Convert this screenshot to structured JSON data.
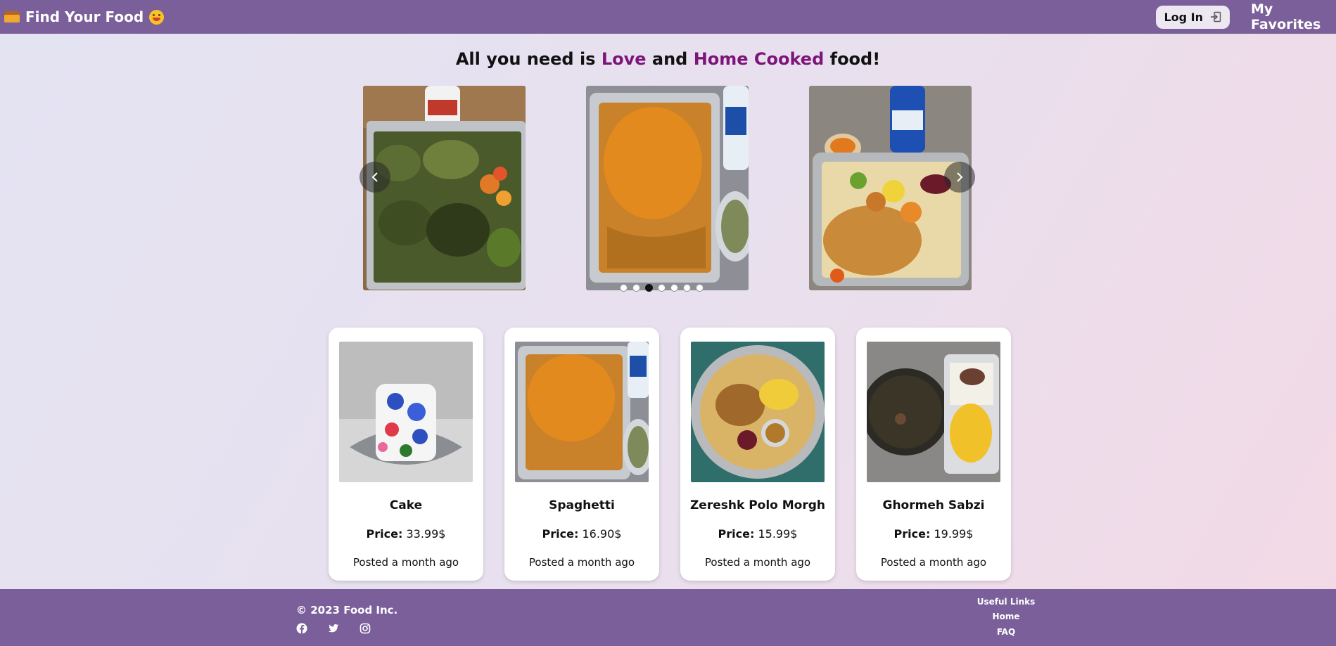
{
  "header": {
    "brand": "Find Your Food",
    "login_label": "Log In",
    "favorites_label": "My Favorites"
  },
  "hero": {
    "prefix": "All you need is ",
    "love": "Love",
    "and": " and ",
    "home_cooked": "Home Cooked",
    "suffix": " food!"
  },
  "carousel": {
    "slides": [
      "stuffed cabbage dolma",
      "spaghetti with sauce",
      "chicken with rice"
    ],
    "dot_count": 7,
    "active_index": 2
  },
  "cards": [
    {
      "name": "Cake",
      "price_label": "Price:",
      "price": "33.99$",
      "posted": "Posted a month ago"
    },
    {
      "name": "Spaghetti",
      "price_label": "Price:",
      "price": "16.90$",
      "posted": "Posted a month ago"
    },
    {
      "name": "Zereshk Polo Morgh",
      "price_label": "Price:",
      "price": "15.99$",
      "posted": "Posted a month ago"
    },
    {
      "name": "Ghormeh Sabzi",
      "price_label": "Price:",
      "price": "19.99$",
      "posted": "Posted a month ago"
    }
  ],
  "footer": {
    "copyright": "© 2023 Food Inc.",
    "useful_links_title": "Useful Links",
    "links": [
      "Home",
      "FAQ"
    ],
    "socials": [
      "facebook-icon",
      "twitter-icon",
      "instagram-icon"
    ]
  },
  "colors": {
    "nav_bg": "#7a5f9a",
    "accent": "#7d1479"
  }
}
